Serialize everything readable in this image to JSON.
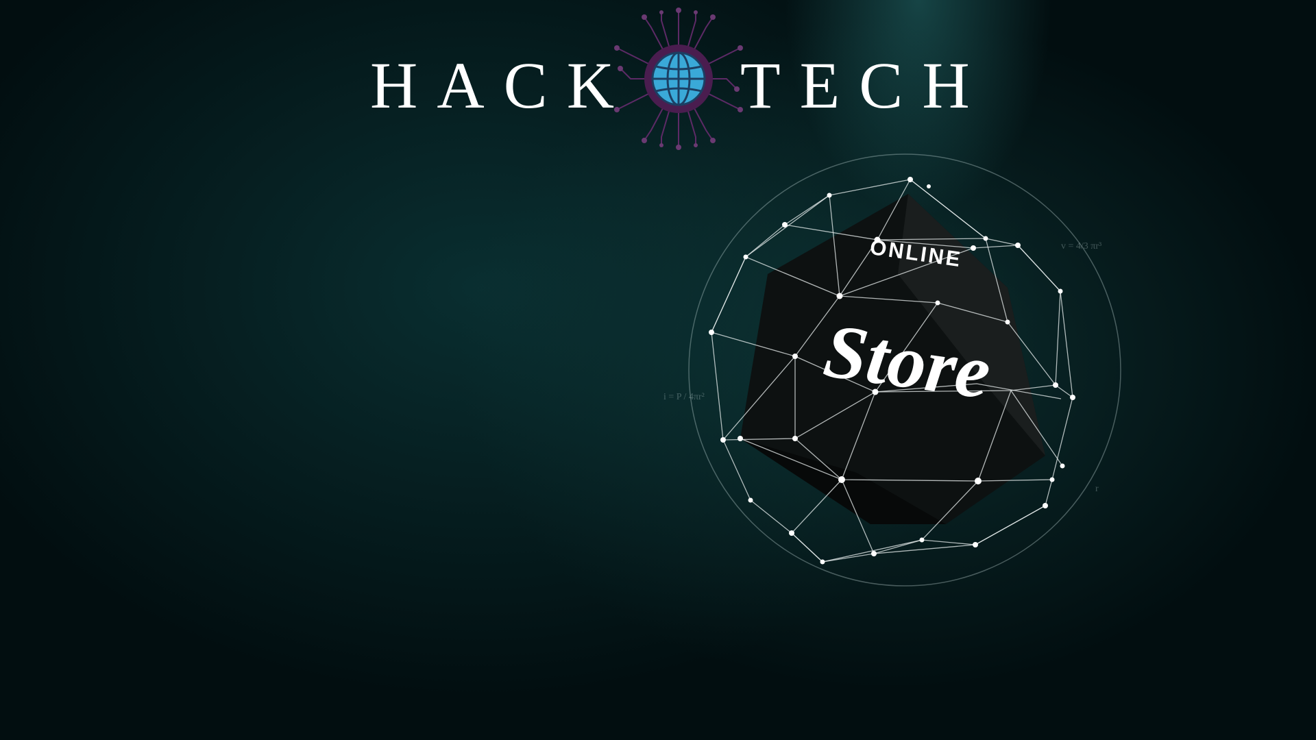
{
  "logo": {
    "left_text": "HACK",
    "right_text": "TECH",
    "emblem_icon": "globe-circuit-icon",
    "emblem_colors": {
      "globe": "#3aa9d8",
      "ring": "#4a1d4f",
      "circuit": "#6a3a72"
    }
  },
  "store_badge": {
    "line1": "ONLINE",
    "line2": "Store"
  },
  "formulas": {
    "volume": "v = 4/3 πr³",
    "intensity": "i = P / 4πr²",
    "radius": "r"
  },
  "colors": {
    "background": "#030d0f",
    "teal_glow": "#2f8f8f",
    "cube": "#111414",
    "mesh": "#ffffff"
  }
}
